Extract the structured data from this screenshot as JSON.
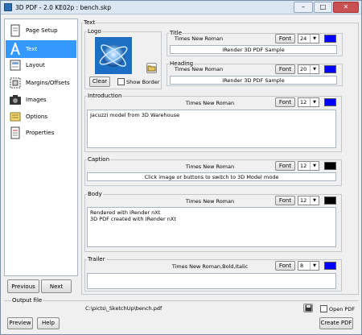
{
  "window": {
    "title": "3D PDF - 2.0 KE02p : bench.skp",
    "min": "–",
    "max": "□",
    "close": "✕"
  },
  "sidebar": {
    "items": [
      {
        "label": "Page Setup",
        "icon": "page-setup-icon"
      },
      {
        "label": "Text",
        "icon": "text-icon"
      },
      {
        "label": "Layout",
        "icon": "layout-icon"
      },
      {
        "label": "Margins/Offsets",
        "icon": "margins-icon"
      },
      {
        "label": "Images",
        "icon": "camera-icon"
      },
      {
        "label": "Options",
        "icon": "options-icon"
      },
      {
        "label": "Properties",
        "icon": "properties-icon"
      }
    ]
  },
  "nav": {
    "previous": "Previous",
    "next": "Next"
  },
  "text_panel": {
    "label": "Text",
    "logo": {
      "label": "Logo",
      "clear": "Clear",
      "show_border": "Show Border",
      "show_border_checked": false
    },
    "title": {
      "label": "Title",
      "font": "Times New Roman",
      "font_button": "Font",
      "size": "24",
      "color": "#0000ff",
      "value": "IRender 3D PDF Sample"
    },
    "heading": {
      "label": "Heading",
      "font": "Times New Roman",
      "font_button": "Font",
      "size": "20",
      "color": "#0000ff",
      "value": "IRender 3D PDF Sample"
    },
    "introduction": {
      "label": "Introduction",
      "font": "Times New Roman",
      "font_button": "Font",
      "size": "12",
      "color": "#0000ff",
      "lines": [
        "Jacuzzi model from 3D Warehouse"
      ]
    },
    "caption": {
      "label": "Caption",
      "font": "Times New Roman",
      "font_button": "Font",
      "size": "12",
      "color": "#000000",
      "value": "Click image or buttons to switch to 3D Model mode"
    },
    "body": {
      "label": "Body",
      "font": "Times New Roman",
      "font_button": "Font",
      "size": "12",
      "color": "#000000",
      "lines": [
        "Rendered with IRender nXt",
        "3D PDF created with IRender nXt"
      ]
    },
    "trailer": {
      "label": "Trailer",
      "font": "Times New Roman,Bold,Italic",
      "font_button": "Font",
      "size": "8",
      "color": "#0000ff",
      "lines": []
    }
  },
  "output": {
    "label": "Output file",
    "path": "C:\\picts\\_SketchUp\\bench.pdf",
    "open_pdf": "Open PDF",
    "open_pdf_checked": false
  },
  "footer": {
    "preview": "Preview",
    "help": "Help",
    "create": "Create PDF"
  }
}
